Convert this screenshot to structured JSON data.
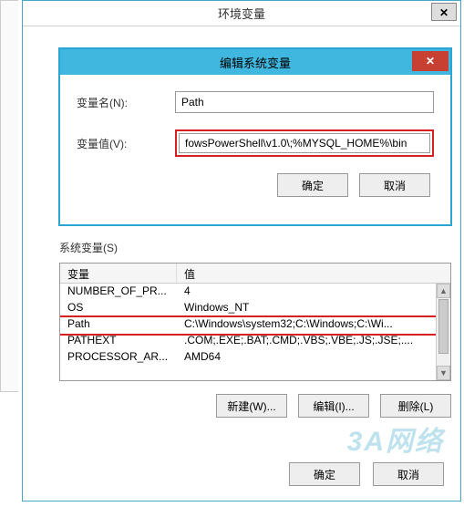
{
  "outer": {
    "title": "环境变量",
    "close": "✕"
  },
  "inner": {
    "title": "编辑系统变量",
    "close": "✕",
    "name_label": "变量名(N):",
    "name_value": "Path",
    "value_label": "变量值(V):",
    "value_value": "fowsPowerShell\\v1.0\\;%MYSQL_HOME%\\bin",
    "ok": "确定",
    "cancel": "取消"
  },
  "sys": {
    "label": "系统变量(S)",
    "col_name": "变量",
    "col_value": "值",
    "rows": [
      {
        "name": "NUMBER_OF_PR...",
        "value": "4"
      },
      {
        "name": "OS",
        "value": "Windows_NT"
      },
      {
        "name": "Path",
        "value": "C:\\Windows\\system32;C:\\Windows;C:\\Wi..."
      },
      {
        "name": "PATHEXT",
        "value": ".COM;.EXE;.BAT;.CMD;.VBS;.VBE;.JS;.JSE;...."
      },
      {
        "name": "PROCESSOR_AR...",
        "value": "AMD64"
      }
    ],
    "new": "新建(W)...",
    "edit": "编辑(I)...",
    "delete": "删除(L)"
  },
  "bottom": {
    "ok": "确定",
    "cancel": "取消"
  },
  "watermark": "3A网络"
}
